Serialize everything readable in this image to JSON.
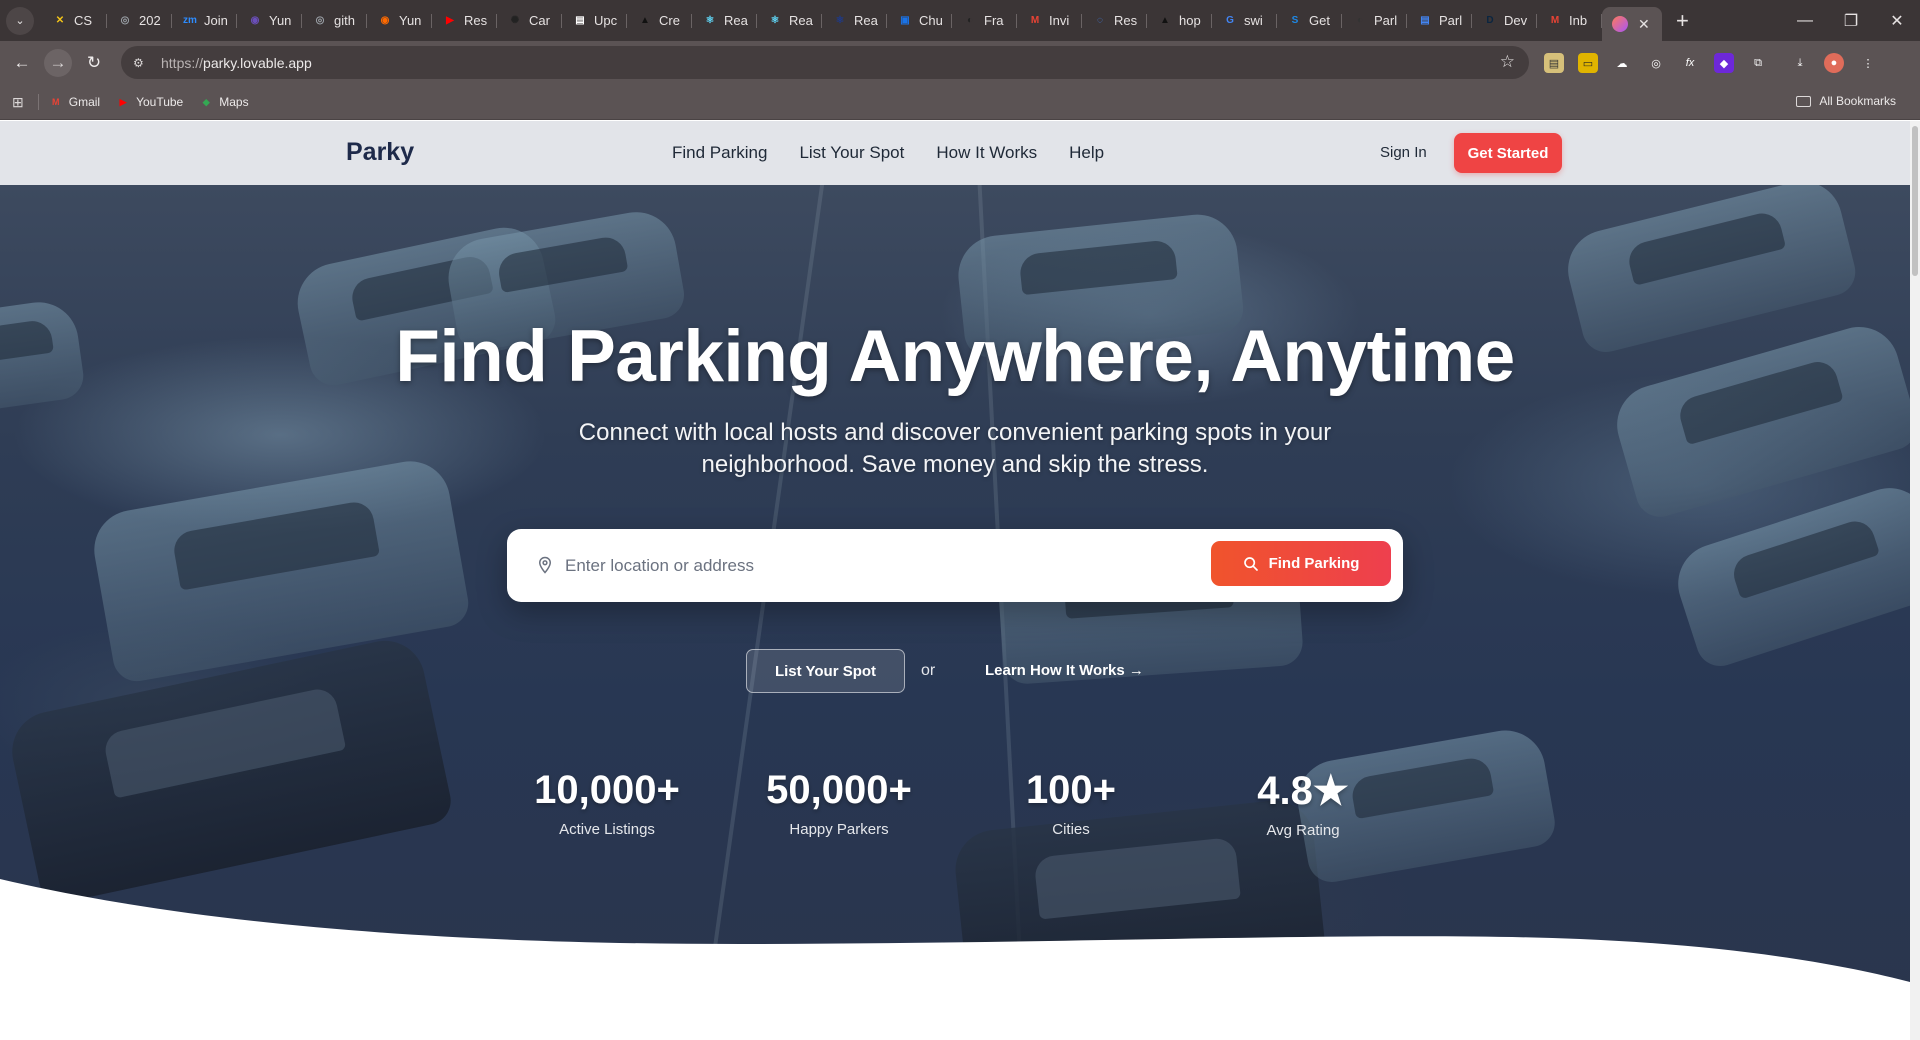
{
  "browser": {
    "tabs": [
      {
        "label": "CS",
        "fav": "✕",
        "color": "#f5c518"
      },
      {
        "label": "202",
        "fav": "◎",
        "color": "#9aa0a6"
      },
      {
        "label": "Join",
        "fav": "zm",
        "color": "#2d8cff"
      },
      {
        "label": "Yun",
        "fav": "◉",
        "color": "#6b4fbb"
      },
      {
        "label": "gith",
        "fav": "◎",
        "color": "#9aa0a6"
      },
      {
        "label": "Yun",
        "fav": "◉",
        "color": "#ff6a00"
      },
      {
        "label": "Res",
        "fav": "▶",
        "color": "#ff0000"
      },
      {
        "label": "Car",
        "fav": "✺",
        "color": "#222222"
      },
      {
        "label": "Upc",
        "fav": "▤",
        "color": "#ffffff"
      },
      {
        "label": "Cre",
        "fav": "▲",
        "color": "#111111"
      },
      {
        "label": "Rea",
        "fav": "⚛",
        "color": "#61dafb"
      },
      {
        "label": "Rea",
        "fav": "⚛",
        "color": "#61dafb"
      },
      {
        "label": "Rea",
        "fav": "⚛",
        "color": "#1e3a8a"
      },
      {
        "label": "Chu",
        "fav": "▣",
        "color": "#1a73e8"
      },
      {
        "label": "Fra",
        "fav": "◐",
        "color": "#222222"
      },
      {
        "label": "Invi",
        "fav": "M",
        "color": "#ea4335"
      },
      {
        "label": "Res",
        "fav": "◌",
        "color": "#4285f4"
      },
      {
        "label": "hop",
        "fav": "▲",
        "color": "#111111"
      },
      {
        "label": "swi",
        "fav": "G",
        "color": "#4285f4"
      },
      {
        "label": "Get",
        "fav": "S",
        "color": "#1e88e5"
      },
      {
        "label": "Parl",
        "fav": "◐",
        "color": "#333333"
      },
      {
        "label": "Parl",
        "fav": "▤",
        "color": "#4285f4"
      },
      {
        "label": "Dev",
        "fav": "D",
        "color": "#0a2540"
      },
      {
        "label": "Inb",
        "fav": "M",
        "color": "#ea4335"
      }
    ],
    "url_scheme": "https://",
    "url_host": "parky.lovable.app",
    "bookmarks": [
      {
        "label": "Gmail",
        "fav": "M",
        "color": "#ea4335"
      },
      {
        "label": "YouTube",
        "fav": "▶",
        "color": "#ff0000"
      },
      {
        "label": "Maps",
        "fav": "◆",
        "color": "#34a853"
      }
    ],
    "all_bookmarks": "All Bookmarks"
  },
  "site": {
    "logo": "Parky",
    "nav": [
      "Find Parking",
      "List Your Spot",
      "How It Works",
      "Help"
    ],
    "sign_in": "Sign In",
    "get_started": "Get Started"
  },
  "hero": {
    "title": "Find Parking Anywhere, Anytime",
    "subtitle": "Connect with local hosts and discover convenient parking spots in your neighborhood. Save money and skip the stress.",
    "search_placeholder": "Enter location or address",
    "find_button": "Find Parking",
    "list_button": "List Your Spot",
    "or": "or",
    "learn_link": "Learn How It Works →"
  },
  "stats": [
    {
      "value": "10,000+",
      "label": "Active Listings"
    },
    {
      "value": "50,000+",
      "label": "Happy Parkers"
    },
    {
      "value": "100+",
      "label": "Cities"
    },
    {
      "value": "4.8★",
      "label": "Avg Rating"
    }
  ],
  "colors": {
    "accent": "#ef4444",
    "logo": "#1e2a4a"
  }
}
